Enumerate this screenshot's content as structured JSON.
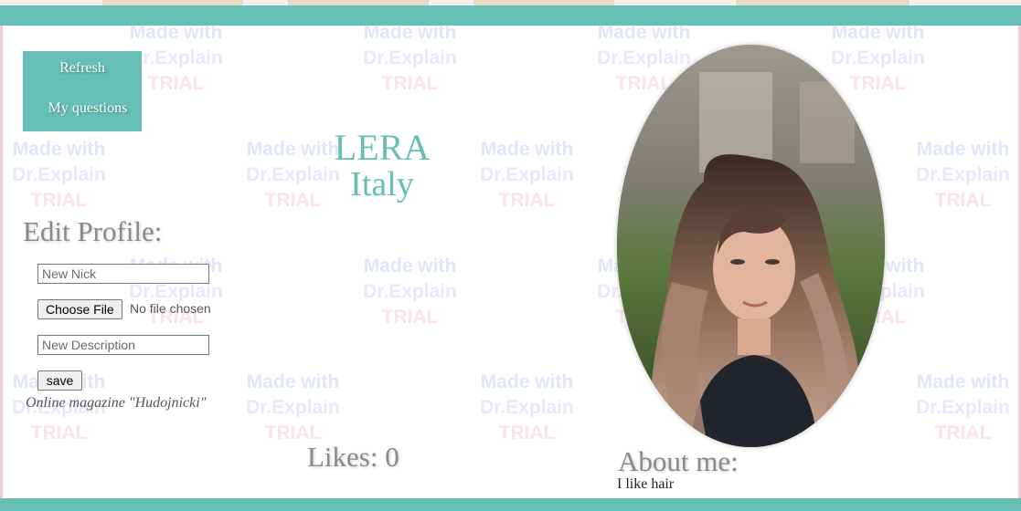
{
  "nav": {
    "refresh_label": "Refresh",
    "questions_label": "My questions"
  },
  "profile": {
    "name": "LERA",
    "country": "Italy",
    "likes": "Likes: 0",
    "about_title": "About me:",
    "about_text": "I like hair"
  },
  "edit": {
    "title": "Edit Profile:",
    "nick_placeholder": "New Nick",
    "choose_file_label": "Choose File",
    "file_status": "No file chosen",
    "description_placeholder": "New Description",
    "save_label": "save",
    "magazine": "Online magazine \"Hudojnicki\""
  },
  "watermark": {
    "line1": "Made with",
    "line2": "Dr.Explain",
    "line3": "TRIAL"
  },
  "colors": {
    "accent": "#66bfb4",
    "heading_gray": "#8a8a8a"
  }
}
